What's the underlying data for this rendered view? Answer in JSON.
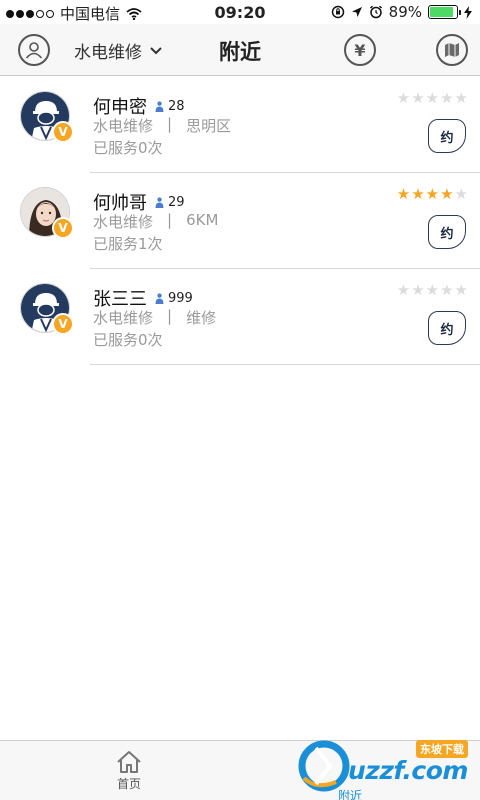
{
  "status_bar": {
    "carrier": "中国电信",
    "time": "09:20",
    "battery_percent": "89%",
    "battery_level": 0.89
  },
  "nav": {
    "category": "水电维修",
    "title": "附近",
    "money_symbol": "¥"
  },
  "workers": [
    {
      "name": "何申密",
      "count": "28",
      "category": "水电维修",
      "separator": "|",
      "location": "思明区",
      "served": "已服务0次",
      "rating": 0,
      "book_label": "约",
      "badge": "V",
      "avatar": "worker"
    },
    {
      "name": "何帅哥",
      "count": "29",
      "category": "水电维修",
      "separator": "|",
      "location": "6KM",
      "served": "已服务1次",
      "rating": 4,
      "book_label": "约",
      "badge": "V",
      "avatar": "photo"
    },
    {
      "name": "张三三",
      "count": "999",
      "category": "水电维修",
      "separator": "|",
      "location": "维修",
      "served": "已服务0次",
      "rating": 0,
      "book_label": "约",
      "badge": "V",
      "avatar": "worker"
    }
  ],
  "tabbar": {
    "home": "首页",
    "nearby": "附近"
  },
  "watermark": {
    "text": "uzzf.com",
    "badge": "东坡下载"
  },
  "colors": {
    "accent": "#1a8fd8",
    "star": "#f5a623",
    "badge": "#f5a623",
    "avatar_bg": "#243a5e"
  }
}
